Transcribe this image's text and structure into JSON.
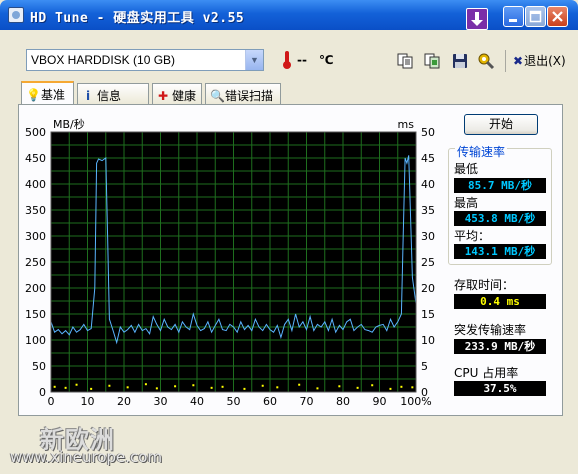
{
  "window": {
    "title": "HD Tune - 硬盘实用工具 v2.55",
    "minimize_label": "_",
    "maximize_label": "□",
    "close_label": "×",
    "purple_button_label": "↓"
  },
  "toolbar": {
    "drive_selected": "VBOX HARDDISK (10 GB)",
    "temperature_value": "--",
    "temperature_unit": "℃",
    "exit_label": "退出(X)",
    "icons": [
      "copy-text-icon",
      "copy-screenshot-icon",
      "save-icon",
      "options-icon",
      "exit-icon",
      "thermometer-icon"
    ]
  },
  "tabs": [
    {
      "label": "基准",
      "icon": "bulb-icon",
      "active": true
    },
    {
      "label": "信息",
      "icon": "info-icon",
      "active": false
    },
    {
      "label": "健康",
      "icon": "health-cross-icon",
      "active": false
    },
    {
      "label": "错误扫描",
      "icon": "magnifier-icon",
      "active": false
    }
  ],
  "benchmark": {
    "start_button": "开始",
    "transfer_rate_title": "传输速率",
    "min_label": "最低",
    "min_value": "85.7 MB/秒",
    "max_label": "最高",
    "max_value": "453.8 MB/秒",
    "avg_label": "平均：",
    "avg_value": "143.1 MB/秒",
    "access_time_label": "存取时间：",
    "access_time_value": "0.4 ms",
    "burst_label": "突发传输速率",
    "burst_value": "233.9 MB/秒",
    "cpu_label": "CPU 占用率",
    "cpu_value": "37.5%"
  },
  "watermark": {
    "text": "新欧洲",
    "url": "www.xineurope.com"
  },
  "colors": {
    "chart_bg": "#000000",
    "grid": "#1e6e1e",
    "transfer_line": "#5ab4ff",
    "access_points": "#ffff00",
    "titlebar": "#0a4fc7",
    "cyan_readout": "#00c8ff",
    "yellow_readout": "#ffff00"
  },
  "chart_data": {
    "type": "line",
    "ylabel": "MB/秒",
    "y2label": "ms",
    "ylim": [
      0,
      500
    ],
    "y2lim": [
      0,
      50
    ],
    "yticks": [
      "0",
      "50",
      "100",
      "150",
      "200",
      "250",
      "300",
      "350",
      "400",
      "450",
      "500"
    ],
    "y2ticks": [
      "0",
      "5",
      "10",
      "15",
      "20",
      "25",
      "30",
      "35",
      "40",
      "45",
      "50"
    ],
    "xticks": [
      "0",
      "10",
      "20",
      "30",
      "40",
      "50",
      "60",
      "70",
      "80",
      "90",
      "100%"
    ],
    "xlim": [
      0,
      100
    ],
    "grid": true,
    "series": [
      {
        "x": [
          0,
          1,
          2,
          3,
          4,
          5,
          6,
          7,
          8,
          9,
          10,
          11,
          12,
          12.5,
          13,
          14,
          15,
          15.5,
          16,
          17,
          18,
          19,
          20,
          21,
          22,
          23,
          24,
          25,
          26,
          27,
          28,
          29,
          30,
          31,
          32,
          33,
          34,
          35,
          36,
          37,
          38,
          39,
          40,
          41,
          42,
          43,
          44,
          45,
          46,
          47,
          48,
          49,
          50,
          51,
          52,
          53,
          54,
          55,
          56,
          57,
          58,
          59,
          60,
          61,
          62,
          63,
          64,
          65,
          66,
          67,
          68,
          69,
          70,
          71,
          72,
          73,
          74,
          75,
          76,
          77,
          78,
          79,
          80,
          81,
          82,
          83,
          84,
          85,
          86,
          87,
          88,
          89,
          90,
          91,
          92,
          93,
          94,
          95,
          96,
          96.5,
          97,
          97.5,
          98,
          99,
          100
        ],
        "y": [
          135,
          115,
          120,
          112,
          118,
          110,
          125,
          115,
          120,
          130,
          118,
          122,
          200,
          440,
          448,
          445,
          450,
          300,
          140,
          118,
          95,
          125,
          115,
          120,
          128,
          115,
          130,
          118,
          122,
          112,
          145,
          130,
          118,
          140,
          125,
          120,
          130,
          115,
          135,
          125,
          120,
          150,
          128,
          118,
          122,
          135,
          115,
          128,
          140,
          120,
          118,
          130,
          125,
          115,
          135,
          120,
          128,
          118,
          140,
          125,
          118,
          130,
          120,
          115,
          128,
          105,
          130,
          140,
          118,
          150,
          125,
          135,
          120,
          145,
          118,
          130,
          125,
          135,
          118,
          140,
          115,
          128,
          120,
          135,
          140,
          118,
          125,
          130,
          120,
          118,
          115,
          125,
          128,
          130,
          118,
          140,
          125,
          135,
          150,
          300,
          450,
          440,
          455,
          220,
          170
        ]
      },
      {
        "name": "access",
        "x": [
          1,
          4,
          7,
          11,
          16,
          21,
          26,
          29,
          34,
          39,
          44,
          47,
          53,
          58,
          62,
          68,
          73,
          79,
          84,
          88,
          93,
          96,
          99
        ],
        "y": [
          1.0,
          0.8,
          1.4,
          0.6,
          1.2,
          0.9,
          1.5,
          0.7,
          1.1,
          1.3,
          0.8,
          1.0,
          0.6,
          1.2,
          0.9,
          1.4,
          0.7,
          1.1,
          0.8,
          1.3,
          0.6,
          1.0,
          0.9
        ]
      }
    ]
  }
}
